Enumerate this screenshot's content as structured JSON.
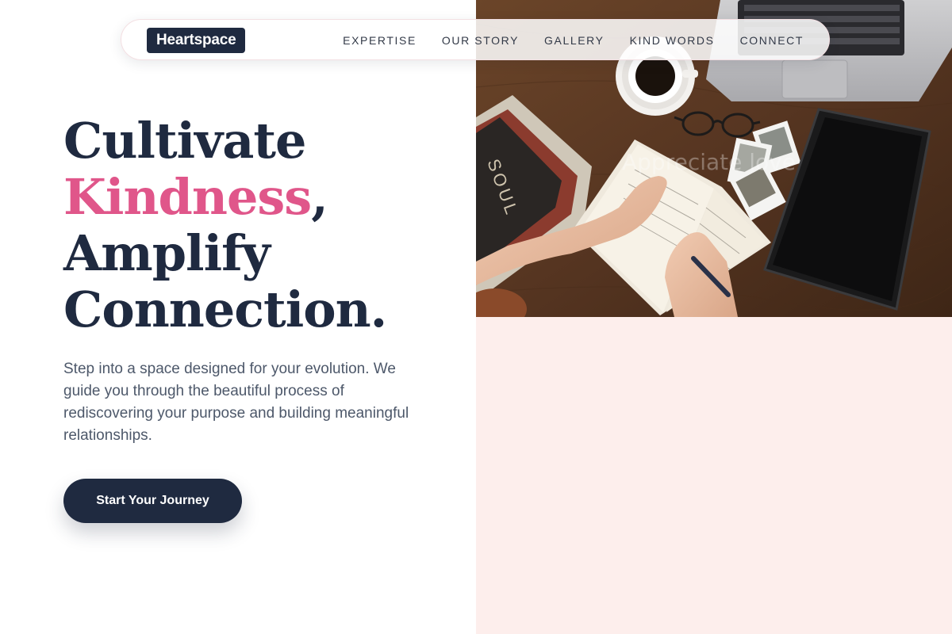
{
  "brand": {
    "logo_text": "Heartspace"
  },
  "nav": {
    "items": [
      {
        "label": "EXPERTISE"
      },
      {
        "label": "OUR STORY"
      },
      {
        "label": "GALLERY"
      },
      {
        "label": "KIND WORDS"
      },
      {
        "label": "CONNECT"
      }
    ]
  },
  "hero": {
    "headline_line1": "Cultivate",
    "headline_accent": "Kindness",
    "headline_accent_suffix": ",",
    "headline_line3": "Amplify",
    "headline_line4": "Connection.",
    "lead": "Step into a space designed for your evolution. We guide you through the beautiful process of rediscovering your purpose and building meaningful relationships.",
    "cta_label": "Start Your Journey",
    "image_overlay_text": "Appreciate love",
    "book_spine_text": "SOUL"
  },
  "colors": {
    "navy": "#1f2a40",
    "accent_pink": "#e0568a",
    "body_text": "#4d586a",
    "pink_panel": "#fdeeec",
    "wood": "#5a3a24"
  }
}
